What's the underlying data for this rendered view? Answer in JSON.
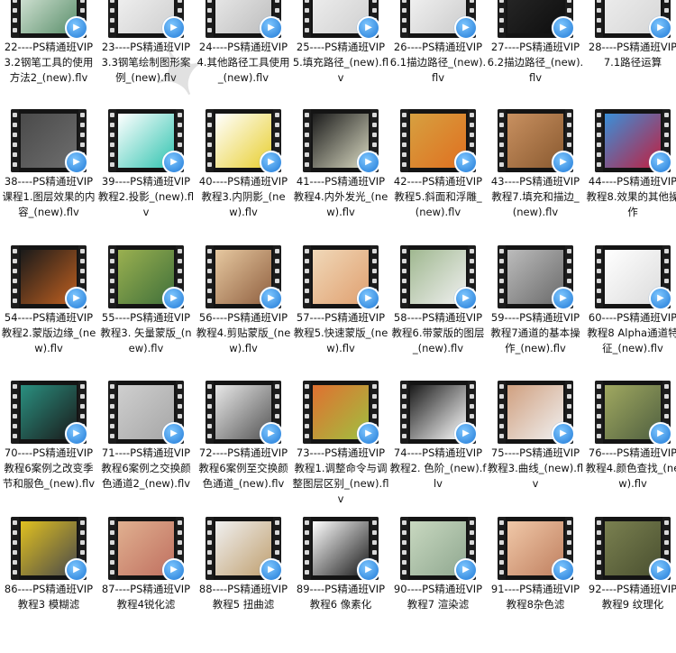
{
  "rows": [
    [
      {
        "label": "22----PS精通班VIP3.2钢笔工具的使用方法2_(new).flv",
        "icon": "video-file-icon",
        "colors": [
          "#e6f0e6",
          "#5a8f6a"
        ]
      },
      {
        "label": "23----PS精通班VIP3.3钢笔绘制图形案例_(new).flv",
        "icon": "video-file-icon",
        "colors": [
          "#f5f5f5",
          "#cfcfcf"
        ]
      },
      {
        "label": "24----PS精通班VIP4.其他路径工具使用_(new).flv",
        "icon": "video-file-icon",
        "colors": [
          "#eeeeee",
          "#bdbdbd"
        ]
      },
      {
        "label": "25----PS精通班VIP5.填充路径_(new).flv",
        "icon": "video-file-icon",
        "colors": [
          "#f2f2f2",
          "#d0d0d0"
        ]
      },
      {
        "label": "26----PS精通班VIP6.1描边路径_(new).flv",
        "icon": "video-file-icon",
        "colors": [
          "#f7f7f7",
          "#cccccc"
        ]
      },
      {
        "label": "27----PS精通班VIP6.2描边路径_(new).flv",
        "icon": "video-file-icon",
        "colors": [
          "#2a2a2a",
          "#0e0e0e"
        ]
      },
      {
        "label": "28----PS精通班VIP7.1路径运算",
        "icon": "video-file-icon",
        "colors": [
          "#f0f0f0",
          "#d6d6d6"
        ]
      }
    ],
    [
      {
        "label": "38----PS精通班VIP课程1.图层效果的内容_(new).flv",
        "icon": "video-file-icon",
        "colors": [
          "#4a4a4a",
          "#6e6e6e"
        ]
      },
      {
        "label": "39----PS精通班VIP教程2.投影_(new).flv",
        "icon": "video-file-icon",
        "colors": [
          "#ffffff",
          "#31c4b0"
        ]
      },
      {
        "label": "40----PS精通班VIP教程3.内阴影_(new).flv",
        "icon": "video-file-icon",
        "colors": [
          "#ffffff",
          "#e8cf30"
        ]
      },
      {
        "label": "41----PS精通班VIP教程4.内外发光_(new).flv",
        "icon": "video-file-icon",
        "colors": [
          "#1c1c1c",
          "#d8d8c0"
        ]
      },
      {
        "label": "42----PS精通班VIP教程5.斜面和浮雕_(new).flv",
        "icon": "video-file-icon",
        "colors": [
          "#d6a040",
          "#e07020"
        ]
      },
      {
        "label": "43----PS精通班VIP教程7.填充和描边_(new).flv",
        "icon": "video-file-icon",
        "colors": [
          "#c89060",
          "#8a5a30"
        ]
      },
      {
        "label": "44----PS精通班VIP教程8.效果的其他操作",
        "icon": "video-file-icon",
        "colors": [
          "#3a8fd8",
          "#c02040"
        ]
      }
    ],
    [
      {
        "label": "54----PS精通班VIP教程2.蒙版边缘_(new).flv",
        "icon": "video-file-icon",
        "colors": [
          "#1a1a1a",
          "#c06020"
        ]
      },
      {
        "label": "55----PS精通班VIP教程3. 矢量蒙版_(new).flv",
        "icon": "video-file-icon",
        "colors": [
          "#9ab050",
          "#40703a"
        ]
      },
      {
        "label": "56----PS精通班VIP教程4.剪贴蒙版_(new).flv",
        "icon": "video-file-icon",
        "colors": [
          "#e6c8a0",
          "#906040"
        ]
      },
      {
        "label": "57----PS精通班VIP教程5.快速蒙版_(new).flv",
        "icon": "video-file-icon",
        "colors": [
          "#f0d8b8",
          "#e0a070"
        ]
      },
      {
        "label": "58----PS精通班VIP教程6.带蒙版的图层_(new).flv",
        "icon": "video-file-icon",
        "colors": [
          "#a0b890",
          "#f0f0f0"
        ]
      },
      {
        "label": "59----PS精通班VIP教程7通道的基本操作_(new).flv",
        "icon": "video-file-icon",
        "colors": [
          "#bcbcbc",
          "#6a6a6a"
        ]
      },
      {
        "label": "60----PS精通班VIP教程8 Alpha通道特征_(new).flv",
        "icon": "video-file-icon",
        "colors": [
          "#ffffff",
          "#dcdcdc"
        ]
      }
    ],
    [
      {
        "label": "70----PS精通班VIP教程6案例之改变季节和服色_(new).flv",
        "icon": "video-file-icon",
        "colors": [
          "#2a9080",
          "#1a1a1a"
        ]
      },
      {
        "label": "71----PS精通班VIP教程6案例之交换颜色通道2_(new).flv",
        "icon": "video-file-icon",
        "colors": [
          "#cfcfcf",
          "#a6a6a6"
        ]
      },
      {
        "label": "72----PS精通班VIP教程6案例至交换颜色通道_(new).flv",
        "icon": "video-file-icon",
        "colors": [
          "#e8e8e8",
          "#555555"
        ]
      },
      {
        "label": "73----PS精通班VIP教程1.调整命令与调整图层区别_(new).flv",
        "icon": "video-file-icon",
        "colors": [
          "#e07030",
          "#a0c040"
        ]
      },
      {
        "label": "74----PS精通班VIP教程2. 色阶_(new).flv",
        "icon": "video-file-icon",
        "colors": [
          "#1a1a1a",
          "#ffffff"
        ]
      },
      {
        "label": "75----PS精通班VIP教程3.曲线_(new).flv",
        "icon": "video-file-icon",
        "colors": [
          "#d0a080",
          "#f0f0f0"
        ]
      },
      {
        "label": "76----PS精通班VIP教程4.颜色查找_(new).flv",
        "icon": "video-file-icon",
        "colors": [
          "#a0a860",
          "#506040"
        ]
      }
    ],
    [
      {
        "label": "86----PS精通班VIP教程3 模糊滤",
        "icon": "video-file-icon",
        "colors": [
          "#e0c020",
          "#4a4a4a"
        ]
      },
      {
        "label": "87----PS精通班VIP教程4锐化滤",
        "icon": "video-file-icon",
        "colors": [
          "#e0b090",
          "#c07060"
        ]
      },
      {
        "label": "88----PS精通班VIP教程5 扭曲滤",
        "icon": "video-file-icon",
        "colors": [
          "#f0f0f0",
          "#c0a070"
        ]
      },
      {
        "label": "89----PS精通班VIP教程6 像素化",
        "icon": "video-file-icon",
        "colors": [
          "#ffffff",
          "#1a1a1a"
        ]
      },
      {
        "label": "90----PS精通班VIP教程7 渲染滤",
        "icon": "video-file-icon",
        "colors": [
          "#c8d8c0",
          "#90a890"
        ]
      },
      {
        "label": "91----PS精通班VIP教程8杂色滤",
        "icon": "video-file-icon",
        "colors": [
          "#f0c8a8",
          "#c08060"
        ]
      },
      {
        "label": "92----PS精通班VIP教程9 纹理化",
        "icon": "video-file-icon",
        "colors": [
          "#7a8050",
          "#4a5030"
        ]
      }
    ]
  ]
}
